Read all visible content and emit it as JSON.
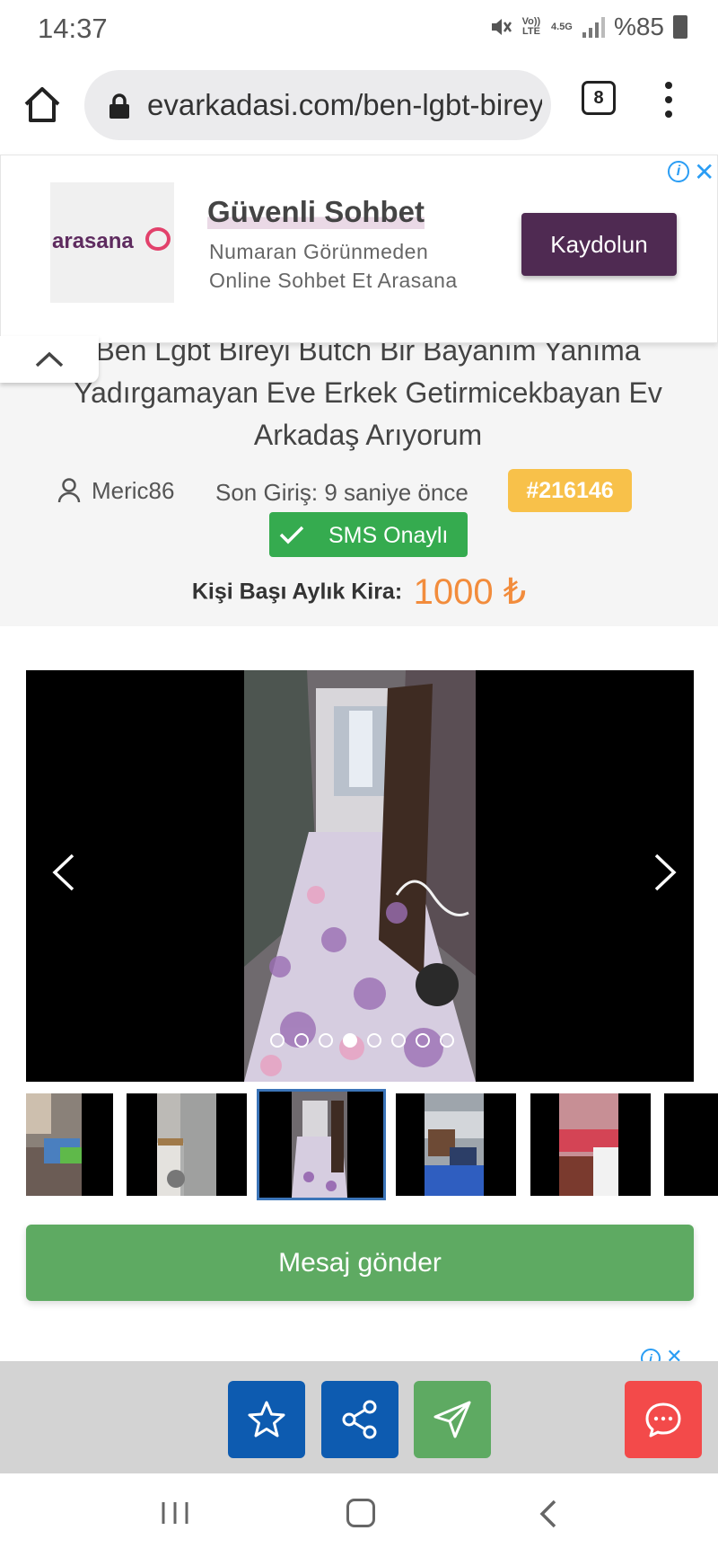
{
  "status_bar": {
    "time": "14:37",
    "net_volte": "Vo)) LTE",
    "net_type": "4.5G",
    "battery": "%85"
  },
  "browser": {
    "url": "evarkadasi.com/ben-lgbt-bireyi",
    "tab_count": "8"
  },
  "ad": {
    "logo_text": "arasana",
    "title": "Güvenli Sohbet",
    "line1": "Numaran Görünmeden",
    "line2": "Online Sohbet Et Arasana",
    "cta": "Kaydolun",
    "info": "i",
    "close": "✕",
    "colors": {
      "cta_bg": "#4f2a52",
      "info": "#2a9df4"
    }
  },
  "listing": {
    "title": "Ben Lgbt Bireyi Butch Bir Bayanım Yanıma Yadırgamayan Eve Erkek Getirmicekbayan Ev Arkadaş Arıyorum",
    "username": "Meric86",
    "last_login": "Son Giriş: 9 saniye önce",
    "id": "#216146",
    "sms_badge": "SMS Onaylı",
    "rent_label": "Kişi Başı Aylık Kira:",
    "rent_value": "1000 ₺"
  },
  "gallery": {
    "photo_count": 8,
    "active_index": 3,
    "thumbnails": [
      "bedroom",
      "bathroom",
      "hallway",
      "living-room",
      "red-bedroom",
      "partial"
    ]
  },
  "actions": {
    "send_message": "Mesaj gönder",
    "colors": {
      "primary": "#0d5bb0",
      "success": "#5eaa62",
      "danger": "#f34a4a",
      "accent": "#f28c3c"
    }
  },
  "icons": [
    "home-icon",
    "lock-icon",
    "more-icon",
    "user-icon",
    "check-icon",
    "star-icon",
    "share-icon",
    "send-icon",
    "chat-icon"
  ]
}
